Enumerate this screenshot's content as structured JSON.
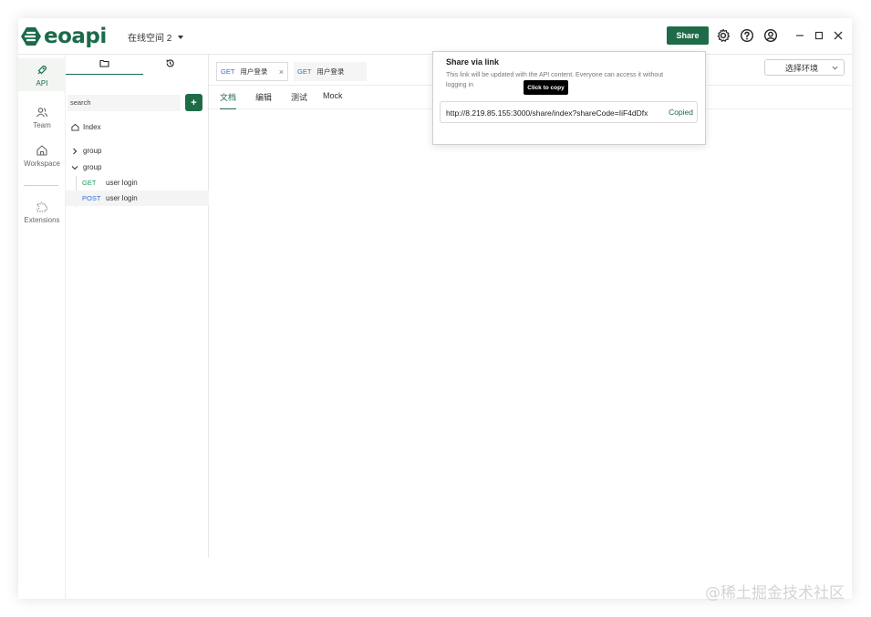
{
  "app": {
    "logo_text": "eoapi",
    "workspace": "在线空间 2",
    "share_label": "Share",
    "brand_color": "#1e6b47"
  },
  "rail": [
    {
      "label": "API",
      "icon": "rocket-icon"
    },
    {
      "label": "Team",
      "icon": "team-icon"
    },
    {
      "label": "Workspace",
      "icon": "home-icon"
    },
    {
      "label": "Extensions",
      "icon": "puzzle-icon"
    }
  ],
  "sidebar": {
    "search_placeholder": "search",
    "add_label": "+",
    "tree": {
      "index": "Index",
      "group1": "group",
      "group2": "group",
      "apis": [
        {
          "method": "GET",
          "name": "user login"
        },
        {
          "method": "POST",
          "name": "user login"
        }
      ]
    }
  },
  "main": {
    "tabs": [
      {
        "method": "GET",
        "name": "用户登录",
        "close": "×"
      },
      {
        "method": "GET",
        "name": "用户登录"
      }
    ],
    "env_select": "选择环境",
    "sub_tabs": [
      "文档",
      "编辑",
      "测试",
      "Mock"
    ]
  },
  "share_popover": {
    "title": "Share via link",
    "description": "This link will be updated with the API content. Everyone can access it without logging in",
    "tooltip": "Click to copy",
    "link": "http://8.219.85.155:3000/share/index?shareCode=IiF4dDfx",
    "copied": "Copied"
  },
  "watermark": "@稀土掘金技术社区"
}
